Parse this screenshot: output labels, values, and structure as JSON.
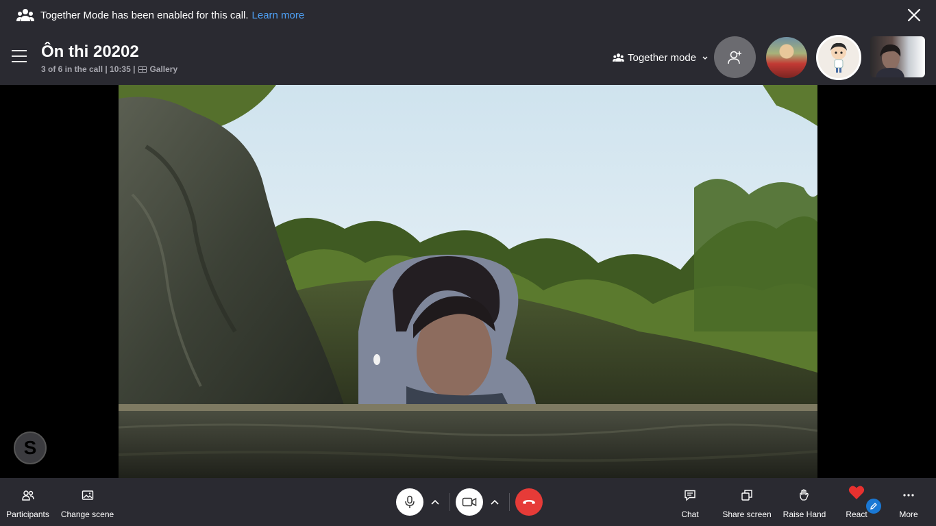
{
  "banner": {
    "text": "Together Mode has been enabled for this call.",
    "link_text": "Learn more",
    "icon": "people-group-icon",
    "close_icon": "close-icon"
  },
  "header": {
    "title": "Ôn thi 20202",
    "subtitle_status": "3 of 6 in the call | 10:35 |",
    "subtitle_view": "Gallery",
    "mode_label": "Together mode",
    "add_people_icon": "add-person-icon"
  },
  "participants": [
    {
      "kind": "photo",
      "accent": "#c23a34"
    },
    {
      "kind": "cartoon",
      "accent": "#f1ece6",
      "selected": true
    },
    {
      "kind": "video",
      "accent": "#5d4a46"
    }
  ],
  "bottom_bar": {
    "participants_label": "Participants",
    "change_scene_label": "Change scene",
    "chat_label": "Chat",
    "share_screen_label": "Share screen",
    "raise_hand_label": "Raise Hand",
    "react_label": "React",
    "more_label": "More"
  },
  "app_logo_letter": "S",
  "colors": {
    "bar_bg": "#2a2a31",
    "link": "#4ea0f5",
    "hangup": "#e63b38",
    "react_heart": "#e8312f",
    "edit_badge": "#1a78d4"
  }
}
